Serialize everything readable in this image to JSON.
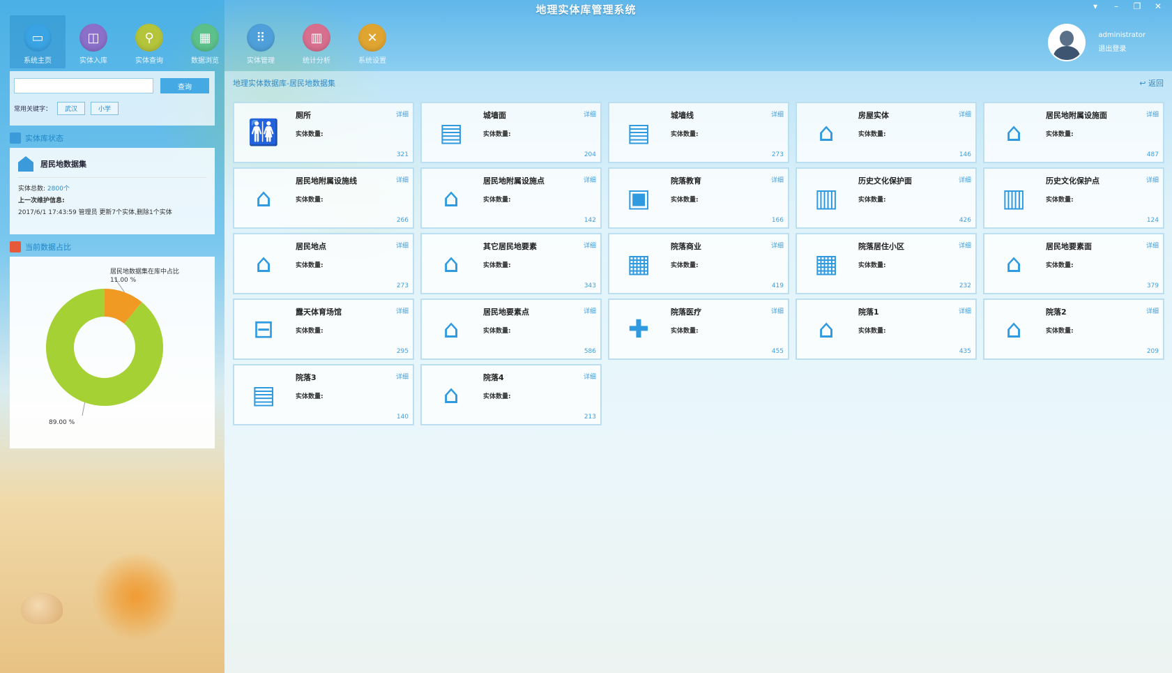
{
  "app": {
    "title": "地理实体库管理系统"
  },
  "window_controls": [
    "▾",
    "–",
    "❐",
    "✕"
  ],
  "nav": [
    {
      "label": "系统主页",
      "icon": "monitor-icon",
      "glyph": "▭",
      "color": "#3aa3e3",
      "active": true
    },
    {
      "label": "实体入库",
      "icon": "database-icon",
      "glyph": "◫",
      "color": "#8b6fc9"
    },
    {
      "label": "实体查询",
      "icon": "search-icon",
      "glyph": "⚲",
      "color": "#b4c43b"
    },
    {
      "label": "数据浏览",
      "icon": "browse-icon",
      "glyph": "▦",
      "color": "#5cc08a"
    },
    {
      "label": "实体管理",
      "icon": "hierarchy-icon",
      "glyph": "⠿",
      "color": "#4fa0da"
    },
    {
      "label": "统计分析",
      "icon": "stats-icon",
      "glyph": "▥",
      "color": "#d86f8f"
    },
    {
      "label": "系统设置",
      "icon": "tools-icon",
      "glyph": "✕",
      "color": "#e0a431"
    }
  ],
  "user": {
    "name": "administrator",
    "logout": "退出登录"
  },
  "search": {
    "placeholder": "",
    "button": "查询",
    "keyword_label": "常用关键字：",
    "keywords": [
      "武汉",
      "小学"
    ]
  },
  "status": {
    "section_title": "实体库状态",
    "dataset_name": "居民地数据集",
    "total_label": "实体总数:",
    "total_value": "2800个",
    "last_maintain_label": "上一次维护信息:",
    "last_maintain_text": "2017/6/1 17:43:59 管理员 更新7个实体,删除1个实体"
  },
  "ratio": {
    "section_title": "当前数据占比"
  },
  "chart_data": {
    "type": "pie",
    "title": "",
    "series": [
      {
        "name": "居民地数据集在库中占比",
        "value": 11.0,
        "label": "11.00 %",
        "color": "#f09a23"
      },
      {
        "name": "",
        "value": 89.0,
        "label": "89.00 %",
        "color": "#a6d135"
      }
    ],
    "annotation": "居民地数据集在库中占比"
  },
  "main": {
    "breadcrumb": "地理实体数据库-居民地数据集",
    "back": "返回",
    "count_label": "实体数量:",
    "detail_label": "详细"
  },
  "cards": [
    {
      "name": "厕所",
      "count": "321",
      "icon": "restroom-icon",
      "glyph": "🚻"
    },
    {
      "name": "城墙面",
      "count": "204",
      "icon": "wall-icon",
      "glyph": "▤"
    },
    {
      "name": "城墙线",
      "count": "273",
      "icon": "wall-line-icon",
      "glyph": "▤"
    },
    {
      "name": "房屋实体",
      "count": "146",
      "icon": "houses-icon",
      "glyph": "⌂"
    },
    {
      "name": "居民地附属设施面",
      "count": "487",
      "icon": "house-facility-icon",
      "glyph": "⌂"
    },
    {
      "name": "居民地附属设施线",
      "count": "266",
      "icon": "house-line-icon",
      "glyph": "⌂"
    },
    {
      "name": "居民地附属设施点",
      "count": "142",
      "icon": "house-point-icon",
      "glyph": "⌂"
    },
    {
      "name": "院落教育",
      "count": "166",
      "icon": "book-icon",
      "glyph": "▣"
    },
    {
      "name": "历史文化保护面",
      "count": "426",
      "icon": "open-book-icon",
      "glyph": "▥"
    },
    {
      "name": "历史文化保护点",
      "count": "124",
      "icon": "open-book-edit-icon",
      "glyph": "▥"
    },
    {
      "name": "居民地点",
      "count": "273",
      "icon": "house-tree-icon",
      "glyph": "⌂"
    },
    {
      "name": "其它居民地要素",
      "count": "343",
      "icon": "house-dots-icon",
      "glyph": "⌂"
    },
    {
      "name": "院落商业",
      "count": "419",
      "icon": "shop-icon",
      "glyph": "▦"
    },
    {
      "name": "院落居住小区",
      "count": "232",
      "icon": "building-icon",
      "glyph": "▦"
    },
    {
      "name": "居民地要素面",
      "count": "379",
      "icon": "house-edit-icon",
      "glyph": "⌂"
    },
    {
      "name": "露天体育场馆",
      "count": "295",
      "icon": "stadium-icon",
      "glyph": "⊟"
    },
    {
      "name": "居民地要素点",
      "count": "586",
      "icon": "house-settings-icon",
      "glyph": "⌂"
    },
    {
      "name": "院落医疗",
      "count": "455",
      "icon": "medical-kit-icon",
      "glyph": "✚"
    },
    {
      "name": "院落1",
      "count": "435",
      "icon": "church-icon",
      "glyph": "⌂"
    },
    {
      "name": "院落2",
      "count": "209",
      "icon": "cottage-icon",
      "glyph": "⌂"
    },
    {
      "name": "院落3",
      "count": "140",
      "icon": "school-icon",
      "glyph": "▤"
    },
    {
      "name": "院落4",
      "count": "213",
      "icon": "chapel-icon",
      "glyph": "⌂"
    }
  ]
}
